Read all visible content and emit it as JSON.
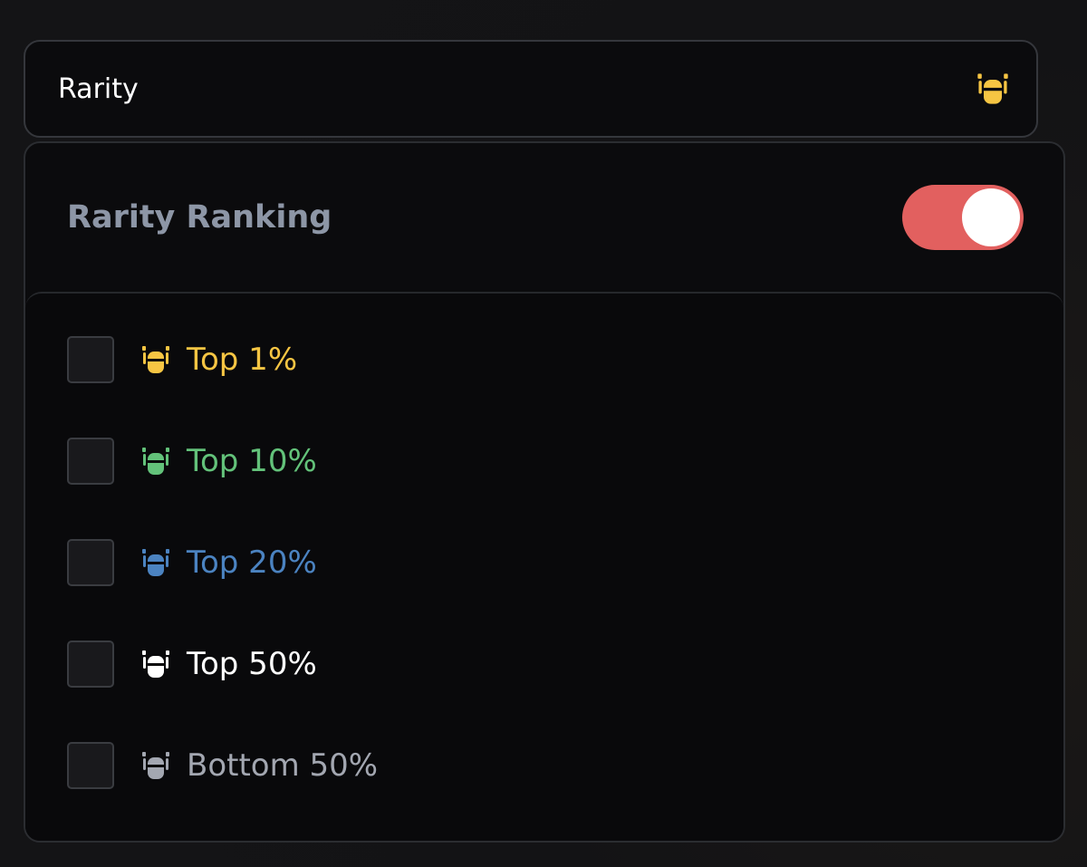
{
  "header": {
    "title": "Rarity",
    "icon": "robot-head-icon",
    "icon_color": "#f6c543"
  },
  "panel": {
    "title": "Rarity Ranking",
    "toggle_on": true,
    "toggle_color": "#e2605f"
  },
  "items": [
    {
      "label": "Top 1%",
      "color": "#f6c543",
      "icon": "robot-head-icon",
      "checked": false
    },
    {
      "label": "Top 10%",
      "color": "#63c27a",
      "icon": "robot-head-icon",
      "checked": false
    },
    {
      "label": "Top 20%",
      "color": "#4b83c1",
      "icon": "robot-head-icon",
      "checked": false
    },
    {
      "label": "Top 50%",
      "color": "#ffffff",
      "icon": "robot-head-icon",
      "checked": false
    },
    {
      "label": "Bottom 50%",
      "color": "#a3a7b1",
      "icon": "robot-head-icon",
      "checked": false
    }
  ]
}
